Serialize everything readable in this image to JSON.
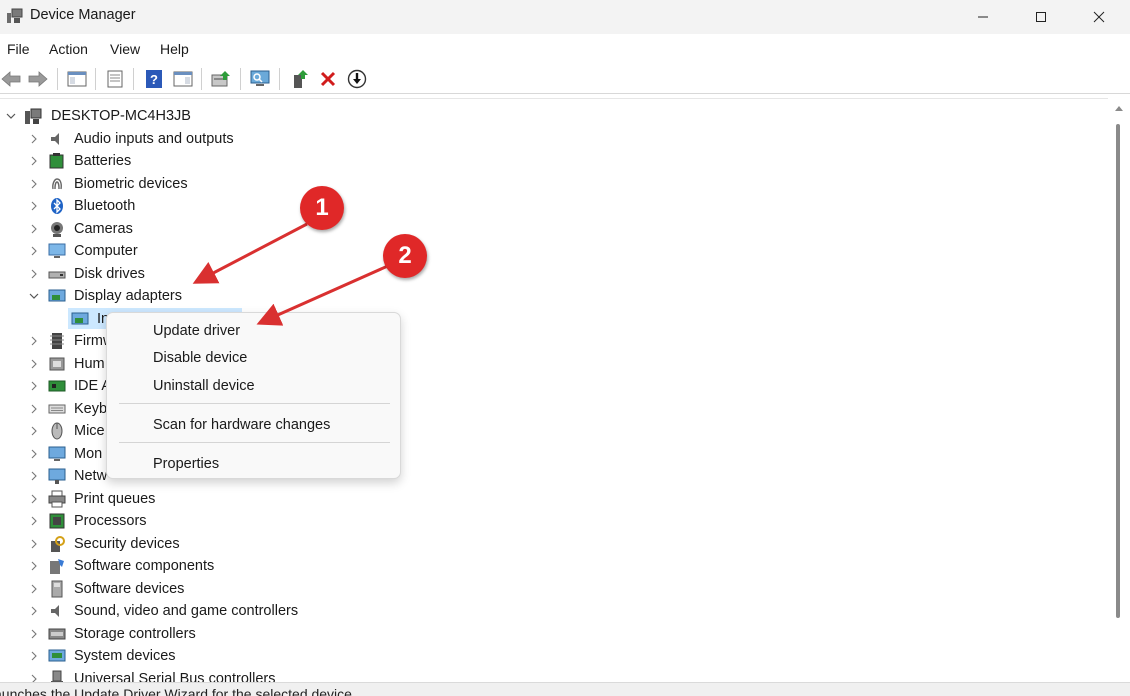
{
  "window": {
    "title": "Device Manager",
    "icon": "device-manager-icon"
  },
  "menu": [
    "File",
    "Action",
    "View",
    "Help"
  ],
  "toolbar": {
    "icons": [
      "back-arrow-icon",
      "forward-arrow-icon",
      "show-hide-console-tree-icon",
      "properties-sheet-icon",
      "help-icon",
      "action-pane-icon",
      "update-driver-icon",
      "scan-hardware-icon",
      "enable-device-icon",
      "uninstall-device-icon",
      "disable-device-icon"
    ]
  },
  "tree": {
    "root": "DESKTOP-MC4H3JB",
    "categories": [
      {
        "label": "Audio inputs and outputs",
        "icon": "speaker-icon"
      },
      {
        "label": "Batteries",
        "icon": "battery-icon"
      },
      {
        "label": "Biometric devices",
        "icon": "fingerprint-icon"
      },
      {
        "label": "Bluetooth",
        "icon": "bluetooth-icon"
      },
      {
        "label": "Cameras",
        "icon": "camera-icon"
      },
      {
        "label": "Computer",
        "icon": "computer-icon"
      },
      {
        "label": "Disk drives",
        "icon": "disk-drive-icon"
      },
      {
        "label": "Display adapters",
        "icon": "display-adapter-icon",
        "expanded": true
      },
      {
        "label": "In",
        "icon": "display-adapter-icon",
        "child": true
      },
      {
        "label": "Firmw",
        "icon": "firmware-icon"
      },
      {
        "label": "Hum",
        "icon": "hid-icon"
      },
      {
        "label": "IDE A",
        "icon": "ide-controller-icon"
      },
      {
        "label": "Keyb",
        "icon": "keyboard-icon"
      },
      {
        "label": "Mice",
        "icon": "mouse-icon"
      },
      {
        "label": "Mon",
        "icon": "monitor-icon"
      },
      {
        "label": "Netw",
        "icon": "network-adapter-icon"
      },
      {
        "label": "Print queues",
        "icon": "printer-icon"
      },
      {
        "label": "Processors",
        "icon": "processor-icon"
      },
      {
        "label": "Security devices",
        "icon": "security-device-icon"
      },
      {
        "label": "Software components",
        "icon": "software-component-icon"
      },
      {
        "label": "Software devices",
        "icon": "software-device-icon"
      },
      {
        "label": "Sound, video and game controllers",
        "icon": "speaker-icon"
      },
      {
        "label": "Storage controllers",
        "icon": "storage-controller-icon"
      },
      {
        "label": "System devices",
        "icon": "system-device-icon"
      },
      {
        "label": "Universal Serial Bus controllers",
        "icon": "usb-icon"
      }
    ]
  },
  "context_menu": {
    "items": [
      "Update driver",
      "Disable device",
      "Uninstall device",
      "Scan for hardware changes",
      "Properties"
    ]
  },
  "callouts": [
    "1",
    "2"
  ],
  "status": "aunches the Update Driver Wizard for the selected device.",
  "colors": {
    "accent": "#0067c0",
    "callout": "#e02828",
    "selection": "#cce8ff"
  }
}
